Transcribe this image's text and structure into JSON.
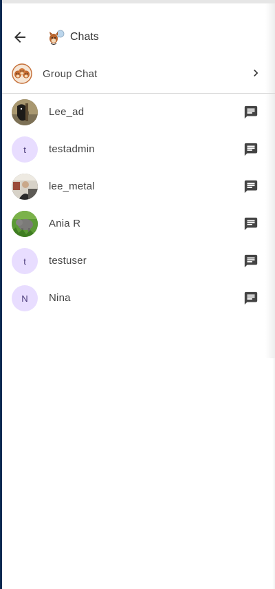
{
  "header": {
    "back_icon": "arrow-left-icon",
    "logo": "chat-logo-icon",
    "title": "Chats"
  },
  "group_chat": {
    "label": "Group Chat",
    "chevron_icon": "chevron-right-icon"
  },
  "users": [
    {
      "name": "Lee_ad",
      "avatar_type": "photo",
      "avatar_initial": "",
      "action_icon": "message-icon"
    },
    {
      "name": "testadmin",
      "avatar_type": "initial",
      "avatar_initial": "t",
      "action_icon": "message-icon"
    },
    {
      "name": "lee_metal",
      "avatar_type": "photo",
      "avatar_initial": "",
      "action_icon": "message-icon"
    },
    {
      "name": "Ania R",
      "avatar_type": "photo",
      "avatar_initial": "",
      "action_icon": "message-icon"
    },
    {
      "name": "testuser",
      "avatar_type": "initial",
      "avatar_initial": "t",
      "action_icon": "message-icon"
    },
    {
      "name": "Nina",
      "avatar_type": "initial",
      "avatar_initial": "N",
      "action_icon": "message-icon"
    }
  ],
  "colors": {
    "initial_avatar_bg": "#e8ddff",
    "initial_avatar_text": "#4a3b7a",
    "icon_color": "#444444",
    "side_strip": "#0b2a52"
  }
}
